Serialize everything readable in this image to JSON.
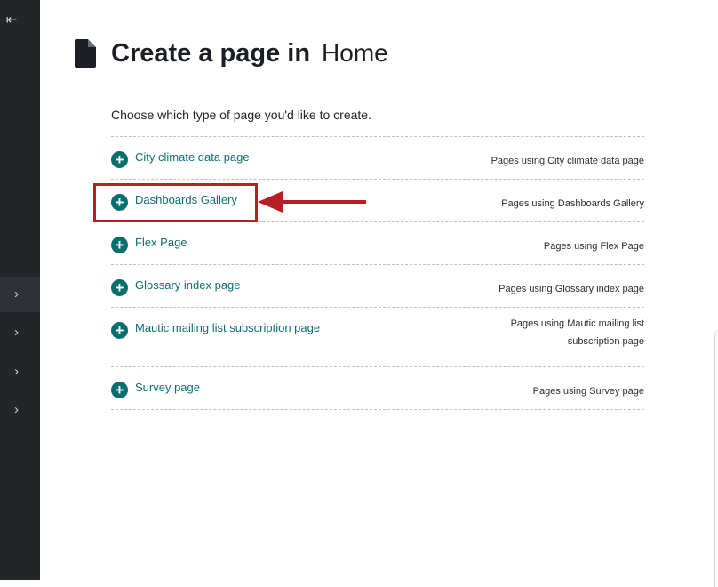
{
  "title": {
    "main": "Create a page in",
    "site": "Home"
  },
  "intro": "Choose which type of page you'd like to create.",
  "page_types": [
    {
      "label": "City climate data page",
      "usage": "Pages using City climate data page"
    },
    {
      "label": "Dashboards Gallery",
      "usage": "Pages using Dashboards Gallery"
    },
    {
      "label": "Flex Page",
      "usage": "Pages using Flex Page"
    },
    {
      "label": "Glossary index page",
      "usage": "Pages using Glossary index page"
    },
    {
      "label": "Mautic mailing list subscription page",
      "usage": "Pages using Mautic mailing list subscription page"
    },
    {
      "label": "Survey page",
      "usage": "Pages using Survey page"
    }
  ],
  "icons": {
    "collapse": "collapse-sidebar-icon",
    "chevron": "chevron-right-icon",
    "page": "document-icon",
    "add": "plus-circle-icon"
  },
  "colors": {
    "sidebar": "#232629",
    "accent": "#0b6e6e",
    "annotation": "#b71f23"
  }
}
